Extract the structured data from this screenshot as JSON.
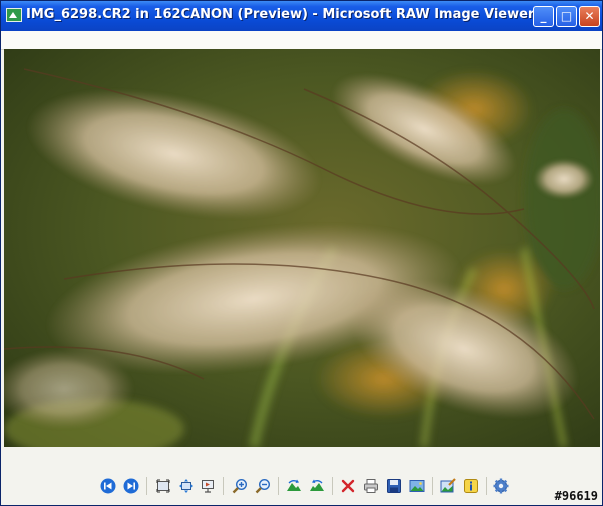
{
  "window": {
    "title": "IMG_6298.CR2 in 162CANON (Preview) - Microsoft RAW Image Viewer",
    "minimize_glyph": "_",
    "maximize_glyph": "□",
    "close_glyph": "✕"
  },
  "toolbar": {
    "tools": [
      {
        "name": "previous-image-button",
        "icon": "previous-icon"
      },
      {
        "name": "next-image-button",
        "icon": "next-icon"
      },
      {
        "name": "actual-size-button",
        "icon": "actual-size-icon"
      },
      {
        "name": "best-fit-button",
        "icon": "best-fit-icon"
      },
      {
        "name": "slideshow-button",
        "icon": "slideshow-icon"
      },
      {
        "name": "zoom-in-button",
        "icon": "zoom-in-icon"
      },
      {
        "name": "zoom-out-button",
        "icon": "zoom-out-icon"
      },
      {
        "name": "rotate-clockwise-button",
        "icon": "rotate-clockwise-icon"
      },
      {
        "name": "rotate-counterclockwise-button",
        "icon": "rotate-counterclockwise-icon"
      },
      {
        "name": "delete-button",
        "icon": "delete-icon"
      },
      {
        "name": "print-button",
        "icon": "print-icon"
      },
      {
        "name": "save-button",
        "icon": "save-icon"
      },
      {
        "name": "open-image-button",
        "icon": "image-icon"
      },
      {
        "name": "edit-button",
        "icon": "edit-icon"
      },
      {
        "name": "info-button",
        "icon": "info-icon"
      },
      {
        "name": "settings-button",
        "icon": "gear-icon"
      }
    ],
    "colors": {
      "primary_blue": "#1f6bd6",
      "delete_red": "#d3252b",
      "green": "#2c9a3c"
    }
  },
  "watermark": "#96619"
}
